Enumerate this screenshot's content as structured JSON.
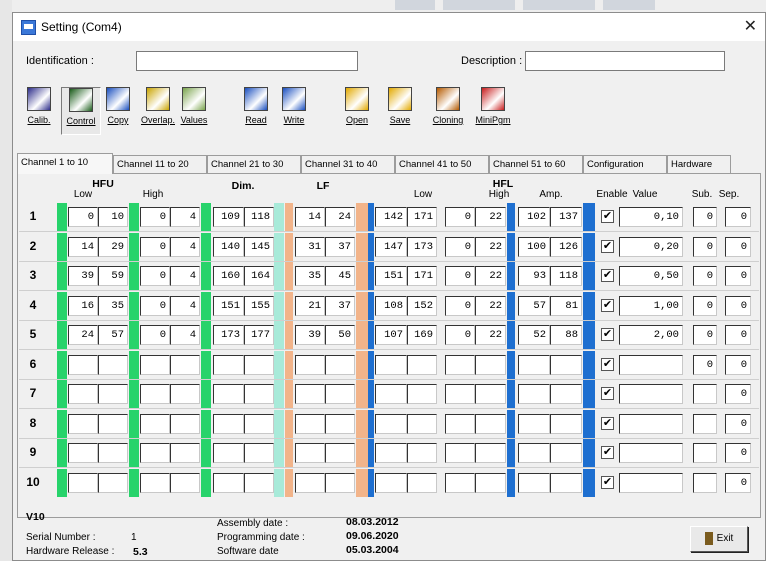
{
  "window": {
    "title": "Setting (Com4)"
  },
  "form": {
    "identification_label": "Identification :",
    "identification_value": "",
    "description_label": "Description :",
    "description_value": ""
  },
  "toolbar": [
    {
      "label": "Calib.",
      "icon": "calibration-icon"
    },
    {
      "label": "Control",
      "icon": "control-icon"
    },
    {
      "label": "Copy",
      "icon": "copy-icon"
    },
    {
      "label": "Overlap.",
      "icon": "overlap-icon"
    },
    {
      "label": "Values",
      "icon": "values-icon"
    },
    {
      "label": "Read",
      "icon": "read-icon"
    },
    {
      "label": "Write",
      "icon": "write-icon"
    },
    {
      "label": "Open",
      "icon": "open-folder-icon"
    },
    {
      "label": "Save",
      "icon": "save-folder-icon"
    },
    {
      "label": "Cloning",
      "icon": "cloning-icon"
    },
    {
      "label": "MiniPgm",
      "icon": "minipgm-icon"
    }
  ],
  "tabs": [
    "Channel 1 to 10",
    "Channel 11 to 20",
    "Channel 21 to 30",
    "Channel 31 to 40",
    "Channel 41 to 50",
    "Channel 51 to 60",
    "Configuration",
    "Hardware"
  ],
  "headers": {
    "hfu": "HFU",
    "hfu_low": "Low",
    "hfu_high": "High",
    "dim": "Dim.",
    "lf": "LF",
    "hfl": "HFL",
    "hfl_low": "Low",
    "hfl_high": "High",
    "amp": "Amp.",
    "enable": "Enable",
    "value": "Value",
    "sub": "Sub.",
    "sep": "Sep."
  },
  "rows": [
    {
      "n": "1",
      "hfu_low": [
        "0",
        "10"
      ],
      "hfu_high": [
        "0",
        "4"
      ],
      "dim": [
        "109",
        "118"
      ],
      "lf": [
        "14",
        "24"
      ],
      "hfl_low": [
        "142",
        "171"
      ],
      "hfl_high": [
        "0",
        "22"
      ],
      "amp": [
        "102",
        "137"
      ],
      "enabled": "✔",
      "value": "0,10",
      "sub": "0",
      "sep": "0"
    },
    {
      "n": "2",
      "hfu_low": [
        "14",
        "29"
      ],
      "hfu_high": [
        "0",
        "4"
      ],
      "dim": [
        "140",
        "145"
      ],
      "lf": [
        "31",
        "37"
      ],
      "hfl_low": [
        "147",
        "173"
      ],
      "hfl_high": [
        "0",
        "22"
      ],
      "amp": [
        "100",
        "126"
      ],
      "enabled": "✔",
      "value": "0,20",
      "sub": "0",
      "sep": "0"
    },
    {
      "n": "3",
      "hfu_low": [
        "39",
        "59"
      ],
      "hfu_high": [
        "0",
        "4"
      ],
      "dim": [
        "160",
        "164"
      ],
      "lf": [
        "35",
        "45"
      ],
      "hfl_low": [
        "151",
        "171"
      ],
      "hfl_high": [
        "0",
        "22"
      ],
      "amp": [
        "93",
        "118"
      ],
      "enabled": "✔",
      "value": "0,50",
      "sub": "0",
      "sep": "0"
    },
    {
      "n": "4",
      "hfu_low": [
        "16",
        "35"
      ],
      "hfu_high": [
        "0",
        "4"
      ],
      "dim": [
        "151",
        "155"
      ],
      "lf": [
        "21",
        "37"
      ],
      "hfl_low": [
        "108",
        "152"
      ],
      "hfl_high": [
        "0",
        "22"
      ],
      "amp": [
        "57",
        "81"
      ],
      "enabled": "✔",
      "value": "1,00",
      "sub": "0",
      "sep": "0"
    },
    {
      "n": "5",
      "hfu_low": [
        "24",
        "57"
      ],
      "hfu_high": [
        "0",
        "4"
      ],
      "dim": [
        "173",
        "177"
      ],
      "lf": [
        "39",
        "50"
      ],
      "hfl_low": [
        "107",
        "169"
      ],
      "hfl_high": [
        "0",
        "22"
      ],
      "amp": [
        "52",
        "88"
      ],
      "enabled": "✔",
      "value": "2,00",
      "sub": "0",
      "sep": "0"
    },
    {
      "n": "6",
      "hfu_low": [
        "",
        ""
      ],
      "hfu_high": [
        "",
        ""
      ],
      "dim": [
        "",
        ""
      ],
      "lf": [
        "",
        ""
      ],
      "hfl_low": [
        "",
        ""
      ],
      "hfl_high": [
        "",
        ""
      ],
      "amp": [
        "",
        ""
      ],
      "enabled": "✔",
      "value": "",
      "sub": "0",
      "sep": "0"
    },
    {
      "n": "7",
      "hfu_low": [
        "",
        ""
      ],
      "hfu_high": [
        "",
        ""
      ],
      "dim": [
        "",
        ""
      ],
      "lf": [
        "",
        ""
      ],
      "hfl_low": [
        "",
        ""
      ],
      "hfl_high": [
        "",
        ""
      ],
      "amp": [
        "",
        ""
      ],
      "enabled": "✔",
      "value": "",
      "sub": "",
      "sep": "0"
    },
    {
      "n": "8",
      "hfu_low": [
        "",
        ""
      ],
      "hfu_high": [
        "",
        ""
      ],
      "dim": [
        "",
        ""
      ],
      "lf": [
        "",
        ""
      ],
      "hfl_low": [
        "",
        ""
      ],
      "hfl_high": [
        "",
        ""
      ],
      "amp": [
        "",
        ""
      ],
      "enabled": "✔",
      "value": "",
      "sub": "",
      "sep": "0"
    },
    {
      "n": "9",
      "hfu_low": [
        "",
        ""
      ],
      "hfu_high": [
        "",
        ""
      ],
      "dim": [
        "",
        ""
      ],
      "lf": [
        "",
        ""
      ],
      "hfl_low": [
        "",
        ""
      ],
      "hfl_high": [
        "",
        ""
      ],
      "amp": [
        "",
        ""
      ],
      "enabled": "✔",
      "value": "",
      "sub": "",
      "sep": "0"
    },
    {
      "n": "10",
      "hfu_low": [
        "",
        ""
      ],
      "hfu_high": [
        "",
        ""
      ],
      "dim": [
        "",
        ""
      ],
      "lf": [
        "",
        ""
      ],
      "hfl_low": [
        "",
        ""
      ],
      "hfl_high": [
        "",
        ""
      ],
      "amp": [
        "",
        ""
      ],
      "enabled": "✔",
      "value": "",
      "sub": "",
      "sep": "0"
    }
  ],
  "footer": {
    "version": "V10",
    "serial_label": "Serial Number :",
    "serial_value": "1",
    "hardware_label": "Hardware Release :",
    "hardware_value": "5.3",
    "assembly_label": "Assembly date :",
    "assembly_value": "08.03.2012",
    "programming_label": "Programming date :",
    "programming_value": "09.06.2020",
    "software_label": "Software date",
    "software_value": "05.03.2004",
    "exit_label": "Exit"
  },
  "colors": {
    "hfu": "#27d36b",
    "dim": "#a8ead9",
    "lf": "#f2b48a",
    "hfl": "#1e6fd0",
    "amp": "#1e6fd0"
  }
}
